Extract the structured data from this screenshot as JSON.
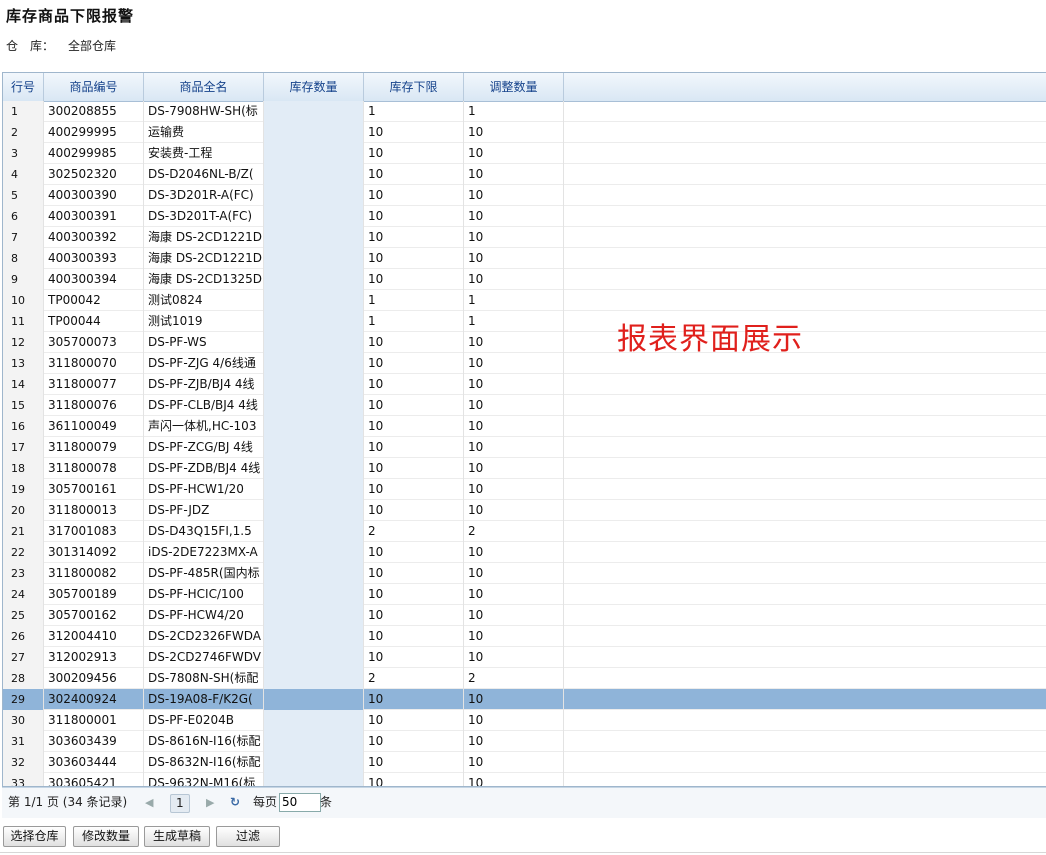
{
  "title": "库存商品下限报警",
  "warehouse": {
    "label": "仓　库：",
    "value": "全部仓库"
  },
  "columns": [
    "行号",
    "商品编号",
    "商品全名",
    "库存数量",
    "库存下限",
    "调整数量"
  ],
  "rows": [
    {
      "n": "1",
      "code": "300208855",
      "name": "DS-7908HW-SH(标",
      "qty": "",
      "min": "1",
      "adj": "1"
    },
    {
      "n": "2",
      "code": "400299995",
      "name": "运输费",
      "qty": "",
      "min": "10",
      "adj": "10"
    },
    {
      "n": "3",
      "code": "400299985",
      "name": "安装费-工程",
      "qty": "",
      "min": "10",
      "adj": "10"
    },
    {
      "n": "4",
      "code": "302502320",
      "name": "DS-D2046NL-B/Z(",
      "qty": "",
      "min": "10",
      "adj": "10"
    },
    {
      "n": "5",
      "code": "400300390",
      "name": "DS-3D201R-A(FC)",
      "qty": "",
      "min": "10",
      "adj": "10"
    },
    {
      "n": "6",
      "code": "400300391",
      "name": "DS-3D201T-A(FC)",
      "qty": "",
      "min": "10",
      "adj": "10"
    },
    {
      "n": "7",
      "code": "400300392",
      "name": "海康 DS-2CD1221D",
      "qty": "",
      "min": "10",
      "adj": "10"
    },
    {
      "n": "8",
      "code": "400300393",
      "name": "海康 DS-2CD1221D",
      "qty": "",
      "min": "10",
      "adj": "10"
    },
    {
      "n": "9",
      "code": "400300394",
      "name": "海康 DS-2CD1325D",
      "qty": "",
      "min": "10",
      "adj": "10"
    },
    {
      "n": "10",
      "code": "TP00042",
      "name": "测试0824",
      "qty": "",
      "min": "1",
      "adj": "1"
    },
    {
      "n": "11",
      "code": "TP00044",
      "name": "测试1019",
      "qty": "",
      "min": "1",
      "adj": "1"
    },
    {
      "n": "12",
      "code": "305700073",
      "name": "DS-PF-WS",
      "qty": "",
      "min": "10",
      "adj": "10"
    },
    {
      "n": "13",
      "code": "311800070",
      "name": "DS-PF-ZJG 4/6线通",
      "qty": "",
      "min": "10",
      "adj": "10"
    },
    {
      "n": "14",
      "code": "311800077",
      "name": "DS-PF-ZJB/BJ4 4线",
      "qty": "",
      "min": "10",
      "adj": "10"
    },
    {
      "n": "15",
      "code": "311800076",
      "name": "DS-PF-CLB/BJ4 4线",
      "qty": "",
      "min": "10",
      "adj": "10"
    },
    {
      "n": "16",
      "code": "361100049",
      "name": "声闪一体机,HC-103",
      "qty": "",
      "min": "10",
      "adj": "10"
    },
    {
      "n": "17",
      "code": "311800079",
      "name": "DS-PF-ZCG/BJ  4线",
      "qty": "",
      "min": "10",
      "adj": "10"
    },
    {
      "n": "18",
      "code": "311800078",
      "name": "DS-PF-ZDB/BJ4 4线",
      "qty": "",
      "min": "10",
      "adj": "10"
    },
    {
      "n": "19",
      "code": "305700161",
      "name": "DS-PF-HCW1/20",
      "qty": "",
      "min": "10",
      "adj": "10"
    },
    {
      "n": "20",
      "code": "311800013",
      "name": "DS-PF-JDZ",
      "qty": "",
      "min": "10",
      "adj": "10"
    },
    {
      "n": "21",
      "code": "317001083",
      "name": "DS-D43Q15FI,1.5",
      "qty": "",
      "min": "2",
      "adj": "2"
    },
    {
      "n": "22",
      "code": "301314092",
      "name": "iDS-2DE7223MX-A",
      "qty": "",
      "min": "10",
      "adj": "10"
    },
    {
      "n": "23",
      "code": "311800082",
      "name": "DS-PF-485R(国内标",
      "qty": "",
      "min": "10",
      "adj": "10"
    },
    {
      "n": "24",
      "code": "305700189",
      "name": "DS-PF-HCIC/100",
      "qty": "",
      "min": "10",
      "adj": "10"
    },
    {
      "n": "25",
      "code": "305700162",
      "name": "DS-PF-HCW4/20",
      "qty": "",
      "min": "10",
      "adj": "10"
    },
    {
      "n": "26",
      "code": "312004410",
      "name": "DS-2CD2326FWDA",
      "qty": "",
      "min": "10",
      "adj": "10"
    },
    {
      "n": "27",
      "code": "312002913",
      "name": "DS-2CD2746FWDV",
      "qty": "",
      "min": "10",
      "adj": "10"
    },
    {
      "n": "28",
      "code": "300209456",
      "name": "DS-7808N-SH(标配",
      "qty": "",
      "min": "2",
      "adj": "2"
    },
    {
      "n": "29",
      "code": "302400924",
      "name": "DS-19A08-F/K2G(",
      "qty": "",
      "min": "10",
      "adj": "10",
      "selected": true
    },
    {
      "n": "30",
      "code": "311800001",
      "name": "DS-PF-E0204B",
      "qty": "",
      "min": "10",
      "adj": "10"
    },
    {
      "n": "31",
      "code": "303603439",
      "name": "DS-8616N-I16(标配",
      "qty": "",
      "min": "10",
      "adj": "10"
    },
    {
      "n": "32",
      "code": "303603444",
      "name": "DS-8632N-I16(标配",
      "qty": "",
      "min": "10",
      "adj": "10"
    },
    {
      "n": "33",
      "code": "303605421",
      "name": "DS-9632N-M16(标",
      "qty": "",
      "min": "10",
      "adj": "10"
    }
  ],
  "overlay_text": "报表界面展示",
  "pager": {
    "info": "第 1/1 页 (34 条记录)",
    "first_icon": "first-page-icon",
    "prev_icon": "prev-page-icon",
    "current": "1",
    "next_icon": "next-page-icon",
    "refresh_icon": "refresh-icon",
    "per_page_label": "每页",
    "per_page_value": "50",
    "per_page_unit": "条"
  },
  "buttons": {
    "select_warehouse": "选择仓库",
    "modify_qty": "修改数量",
    "generate_draft": "生成草稿",
    "filter": "过滤"
  }
}
